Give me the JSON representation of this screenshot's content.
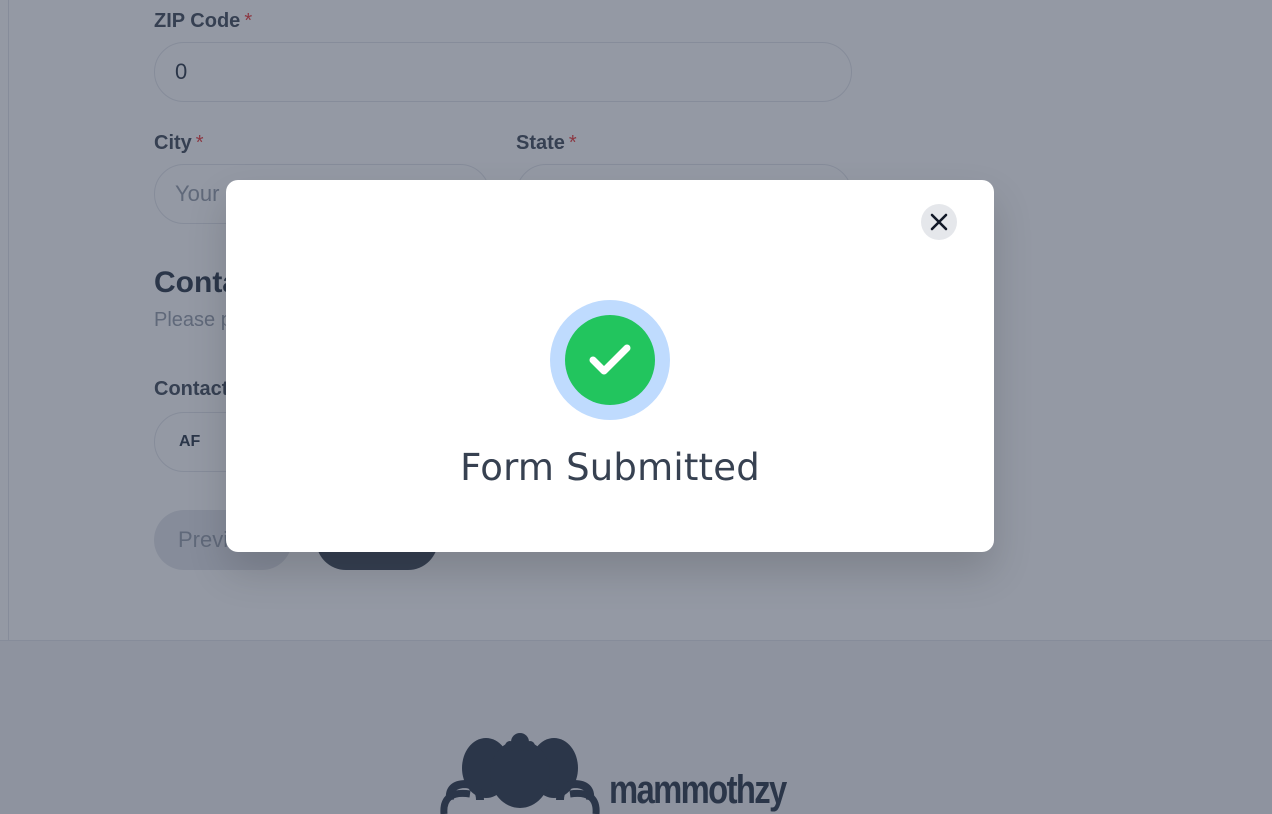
{
  "form": {
    "zip": {
      "label": "ZIP Code",
      "required": "*",
      "value": "0"
    },
    "city": {
      "label": "City",
      "required": "*",
      "placeholder": "Your city"
    },
    "state": {
      "label": "State",
      "required": "*"
    },
    "contact_section": {
      "title": "Contact information",
      "subtitle": "Please provide your contact details"
    },
    "contact_field": {
      "label": "Contact",
      "country_code": "AF"
    },
    "buttons": {
      "previous": "Previous"
    }
  },
  "footer": {
    "brand": "mammothzy"
  },
  "modal": {
    "title": "Form Submitted",
    "close_icon": "close-icon",
    "status_icon": "check-circle-icon",
    "colors": {
      "success": "#22c55e",
      "ring": "#bfdbfe"
    }
  }
}
